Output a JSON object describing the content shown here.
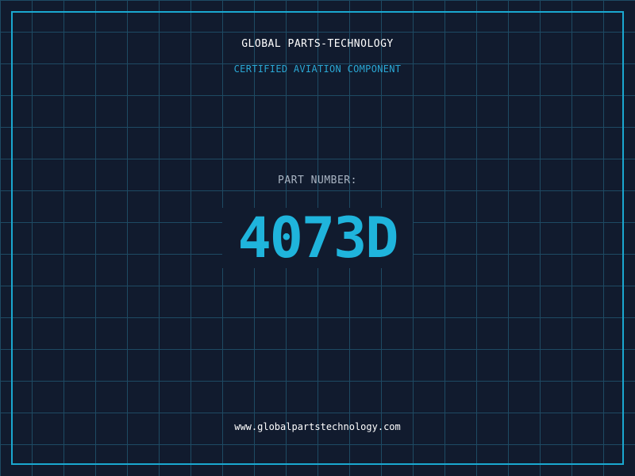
{
  "header": {
    "company": "GLOBAL PARTS-TECHNOLOGY",
    "subtitle": "CERTIFIED AVIATION COMPONENT"
  },
  "part": {
    "label": "PART NUMBER:",
    "number": "4073D"
  },
  "footer": {
    "url": "www.globalpartstechnology.com"
  },
  "colors": {
    "background": "#111b2e",
    "grid": "#1e4a63",
    "accent": "#1fb4dc",
    "frame": "#1aa8d0",
    "label": "#a9b4c2",
    "text": "#ffffff"
  }
}
